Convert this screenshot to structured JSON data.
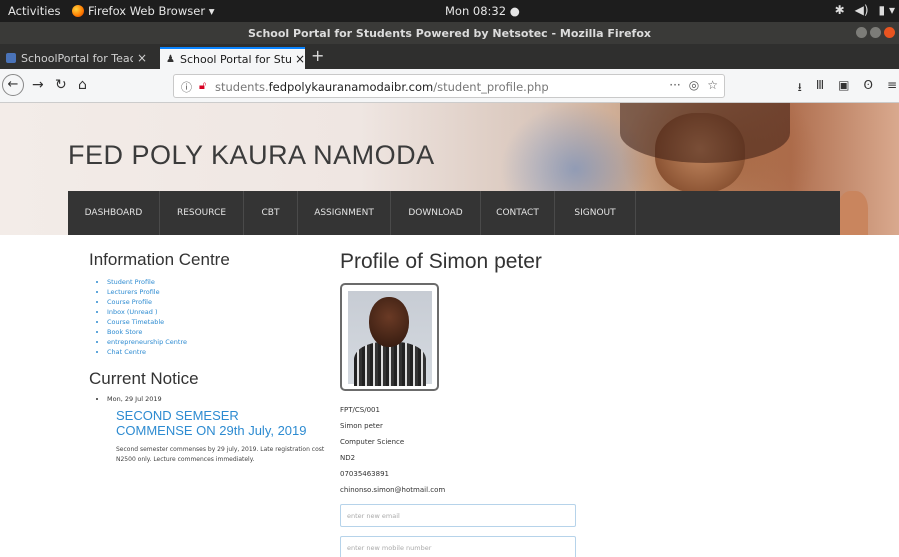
{
  "os": {
    "activities": "Activities",
    "app_name": "Firefox Web Browser ▾",
    "clock": "Mon 08:32 ●"
  },
  "window": {
    "title": "School Portal for Students Powered by Netsotec - Mozilla Firefox"
  },
  "tabs": [
    {
      "label": "SchoolPortal for Teache",
      "active": false
    },
    {
      "label": "School Portal for Studen",
      "active": true
    }
  ],
  "urlbar": {
    "prefix": "students.",
    "domain": "fedpolykauranamodaibr.com",
    "path": "/student_profile.php"
  },
  "site": {
    "title": "FED POLY KAURA NAMODA",
    "menu": [
      "DASHBOARD",
      "RESOURCE",
      "CBT",
      "ASSIGNMENT",
      "DOWNLOAD",
      "CONTACT",
      "SIGNOUT"
    ]
  },
  "info_centre": {
    "heading": "Information Centre",
    "links": [
      "Student Profile",
      "Lecturers Profile",
      "Course Profile",
      "Inbox (Unread )",
      "Course Timetable",
      "Book Store",
      "entrepreneurship Centre",
      "Chat Centre"
    ]
  },
  "notice": {
    "heading": "Current Notice",
    "date": "Mon, 29 Jul 2019",
    "title": "SECOND SEMESER COMMENSE ON 29th July, 2019",
    "text": "Second semester commenses by 29 july, 2019. Late registration cost N2500 only. Lecture commences immediately."
  },
  "profile": {
    "heading": "Profile of Simon peter",
    "reg_no": "FPT/CS/001",
    "name": "Simon peter",
    "department": "Computer Science",
    "level": "ND2",
    "phone": "07035463891",
    "email": "chinonso.simon@hotmail.com",
    "email_placeholder": "enter new email",
    "phone_placeholder": "enter new mobile number"
  },
  "colors": {
    "accent": "#2d8bd1",
    "menu_bg": "#343434",
    "tab_highlight": "#0a84ff"
  }
}
